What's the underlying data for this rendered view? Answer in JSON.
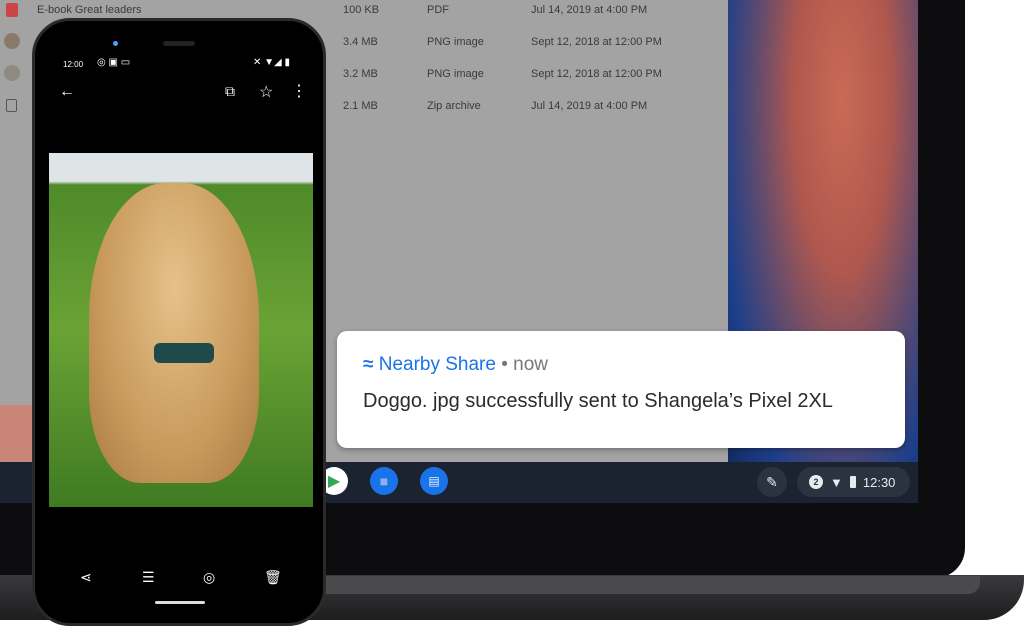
{
  "files": [
    {
      "name": "E-book Great leaders",
      "size": "100 KB",
      "type": "PDF",
      "date": "Jul 14, 2019 at 4:00 PM",
      "icon": "pdf-icon"
    },
    {
      "name": "",
      "size": "3.4 MB",
      "type": "PNG image",
      "date": "Sept 12, 2018 at 12:00 PM",
      "icon": "avatar"
    },
    {
      "name": "",
      "size": "3.2 MB",
      "type": "PNG image",
      "date": "Sept 12, 2018 at 12:00 PM",
      "icon": "avatar"
    },
    {
      "name": "",
      "size": "2.1 MB",
      "type": "Zip archive",
      "date": "Jul 14, 2019 at 4:00 PM",
      "icon": "zip-icon"
    }
  ],
  "notification": {
    "app": "Nearby Share",
    "meta": " • now",
    "body": "Doggo. jpg successfully sent to Shangela’s Pixel 2XL",
    "accent": "#1a73e8"
  },
  "shelf": {
    "apps": [
      "play-store-icon",
      "files-icon",
      "messages-icon"
    ],
    "notification_count": "2",
    "time": "12:30"
  },
  "phone": {
    "status_time": "12:00",
    "actions": [
      "share-icon",
      "edit-icon",
      "lens-icon",
      "delete-icon"
    ]
  }
}
